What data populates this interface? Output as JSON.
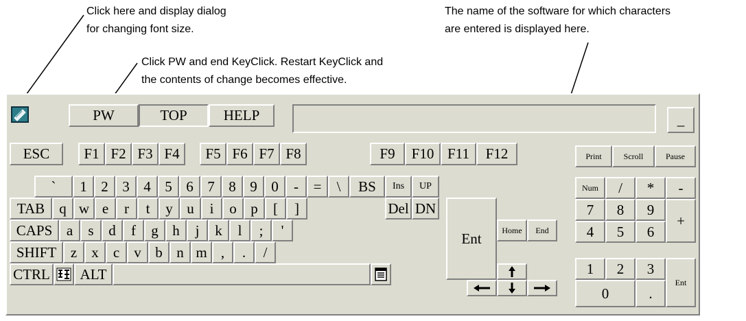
{
  "annotations": {
    "font_dialog": [
      "Click here and display dialog",
      "for changing font size."
    ],
    "pw_note": [
      "Click PW and end KeyClick. Restart KeyClick and",
      "the contents of change becomes effective."
    ],
    "software_name": [
      "The name of the software for which characters",
      "are entered is displayed here."
    ]
  },
  "toolbar": {
    "pw": "PW",
    "top": "TOP",
    "help": "HELP",
    "software_name_field": "",
    "minimize": "_"
  },
  "keys": {
    "row1": [
      "ESC",
      "F1",
      "F2",
      "F3",
      "F4",
      "F5",
      "F6",
      "F7",
      "F8",
      "F9",
      "F10",
      "F11",
      "F12"
    ],
    "row1_right": [
      "Print",
      "Scroll",
      "Pause"
    ],
    "row2": [
      "`",
      "1",
      "2",
      "3",
      "4",
      "5",
      "6",
      "7",
      "8",
      "9",
      "0",
      "-",
      "=",
      "\\",
      "BS",
      "Ins",
      "UP"
    ],
    "row3": [
      "TAB",
      "q",
      "w",
      "e",
      "r",
      "t",
      "y",
      "u",
      "i",
      "o",
      "p",
      "[",
      "]",
      "Del",
      "DN"
    ],
    "row4": [
      "CAPS",
      "a",
      "s",
      "d",
      "f",
      "g",
      "h",
      "j",
      "k",
      "l",
      ";",
      "'",
      "Ent",
      "Home",
      "End"
    ],
    "row5": [
      "SHIFT",
      "z",
      "x",
      "c",
      "v",
      "b",
      "n",
      "m",
      ",",
      ".",
      "/"
    ],
    "row6": [
      "CTRL",
      "ALT"
    ],
    "numpad": [
      "Num",
      "/",
      "*",
      "-",
      "7",
      "8",
      "9",
      "+",
      "4",
      "5",
      "6",
      "1",
      "2",
      "3",
      "Ent",
      "0",
      "."
    ]
  },
  "colors": {
    "panel_bg": "#dcdcd0",
    "bevel_light": "#ffffff",
    "bevel_dark": "#808080"
  },
  "icons": [
    "font-size-icon",
    "ime-icon",
    "menu-key-icon",
    "up-arrow-icon",
    "down-arrow-icon",
    "left-arrow-icon",
    "right-arrow-icon"
  ]
}
